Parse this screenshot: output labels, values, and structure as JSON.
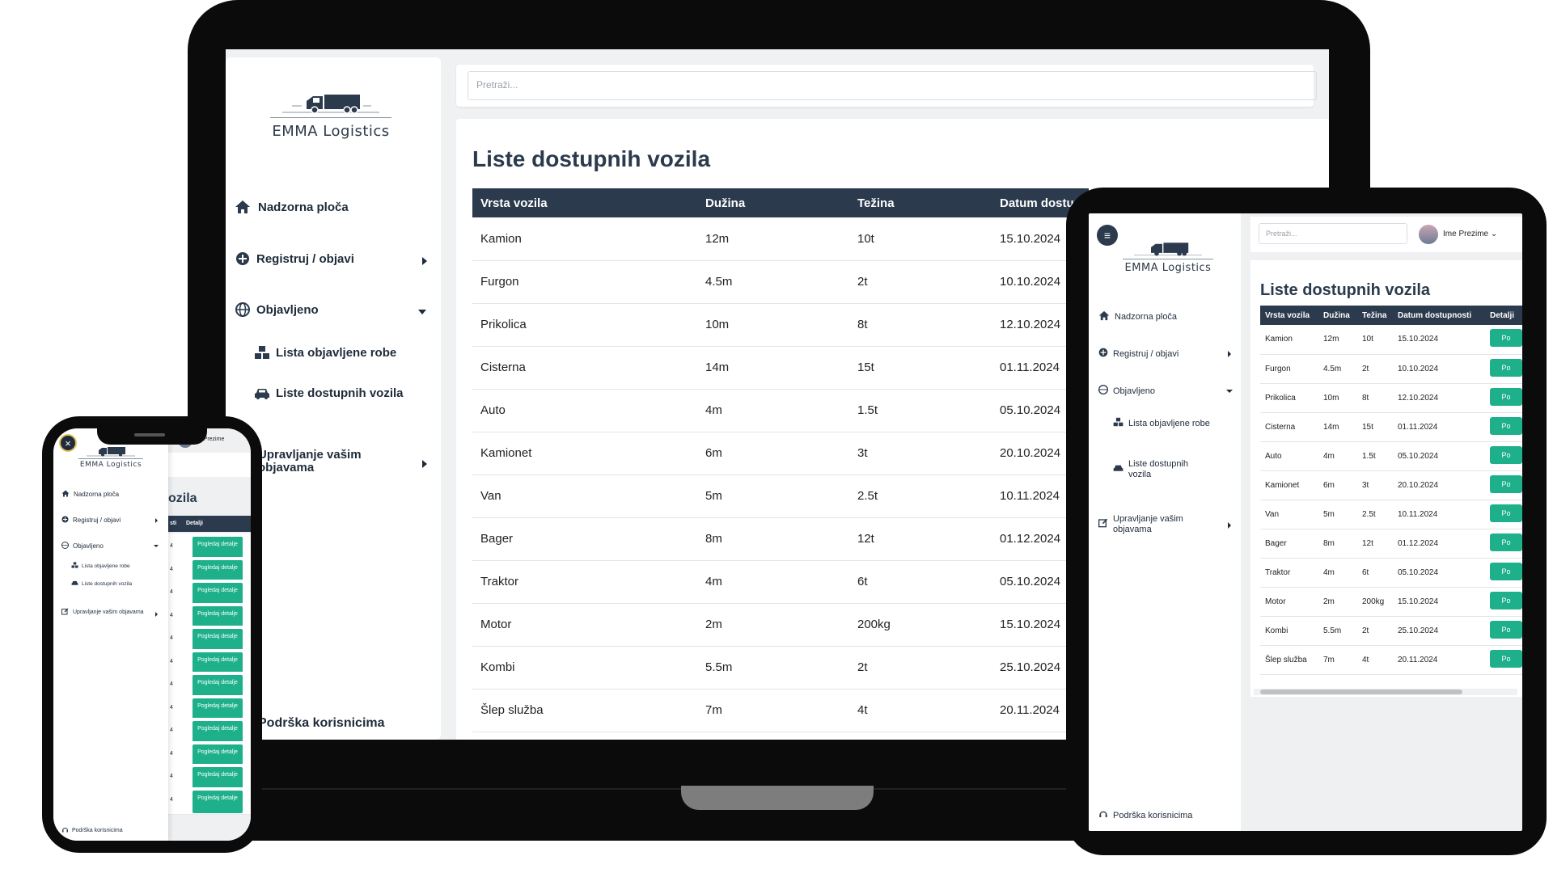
{
  "brand": "EMMA Logistics",
  "search_placeholder": "Pretraži...",
  "user_name": "Ime Prezime",
  "page_title": "Liste dostupnih vozila",
  "nav": {
    "dashboard": "Nadzorna ploča",
    "register": "Registruj / objavi",
    "published": "Objavljeno",
    "goods_list": "Lista objavljene robe",
    "vehicles_list": "Liste dostupnih vozila",
    "manage": "Upravljanje vašim objavama",
    "support": "Podrška korisnicima"
  },
  "columns": {
    "type": "Vrsta vozila",
    "length": "Dužina",
    "weight": "Težina",
    "date_laptop": "Datum dostup",
    "date": "Datum dostupnosti",
    "details": "Detalji",
    "details_short": "Detalji",
    "phone_partial": "sti"
  },
  "button_label": "Pogledaj detalje",
  "button_partial": "Po",
  "phone_cell_partial": "4",
  "phone_user_partial": "me Prezime",
  "phone_title_partial": "ozila",
  "vehicles": [
    {
      "type": "Kamion",
      "length": "12m",
      "weight": "10t",
      "date": "15.10.2024"
    },
    {
      "type": "Furgon",
      "length": "4.5m",
      "weight": "2t",
      "date": "10.10.2024"
    },
    {
      "type": "Prikolica",
      "length": "10m",
      "weight": "8t",
      "date": "12.10.2024"
    },
    {
      "type": "Cisterna",
      "length": "14m",
      "weight": "15t",
      "date": "01.11.2024"
    },
    {
      "type": "Auto",
      "length": "4m",
      "weight": "1.5t",
      "date": "05.10.2024"
    },
    {
      "type": "Kamionet",
      "length": "6m",
      "weight": "3t",
      "date": "20.10.2024"
    },
    {
      "type": "Van",
      "length": "5m",
      "weight": "2.5t",
      "date": "10.11.2024"
    },
    {
      "type": "Bager",
      "length": "8m",
      "weight": "12t",
      "date": "01.12.2024"
    },
    {
      "type": "Traktor",
      "length": "4m",
      "weight": "6t",
      "date": "05.10.2024"
    },
    {
      "type": "Motor",
      "length": "2m",
      "weight": "200kg",
      "date": "15.10.2024"
    },
    {
      "type": "Kombi",
      "length": "5.5m",
      "weight": "2t",
      "date": "25.10.2024"
    },
    {
      "type": "Šlep služba",
      "length": "7m",
      "weight": "4t",
      "date": "20.11.2024"
    }
  ],
  "colors": {
    "navy": "#2b3a4d",
    "accent_green": "#1db08a",
    "device_black": "#0b0b0b"
  }
}
